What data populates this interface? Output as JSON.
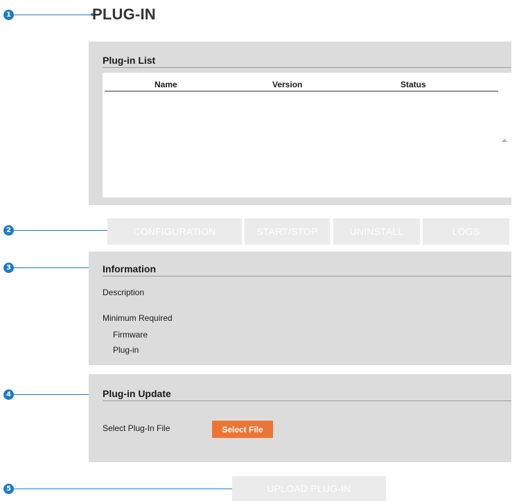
{
  "page": {
    "title": "PLUG-IN"
  },
  "callouts": [
    "1",
    "2",
    "3",
    "4",
    "5"
  ],
  "plugin_list": {
    "title": "Plug-in List",
    "columns": [
      "Name",
      "Version",
      "Status"
    ],
    "rows": []
  },
  "actions": {
    "configuration": "CONFIGURATION",
    "start_stop": "START/STOP",
    "uninstall": "UNINSTALL",
    "logs": "LOGS"
  },
  "information": {
    "title": "Information",
    "description_label": "Description",
    "minimum_required_label": "Minimum Required",
    "firmware_label": "Firmware",
    "plugin_label": "Plug-in"
  },
  "plugin_update": {
    "title": "Plug-in Update",
    "select_file_label": "Select Plug-In File",
    "select_file_button": "Select File"
  },
  "upload": {
    "button": "UPLOAD PLUG-IN"
  },
  "colors": {
    "callout": "#1e7bc4",
    "panel_bg": "#dcdcdc",
    "accent_button": "#ec7434",
    "disabled_button": "#ebebeb"
  }
}
